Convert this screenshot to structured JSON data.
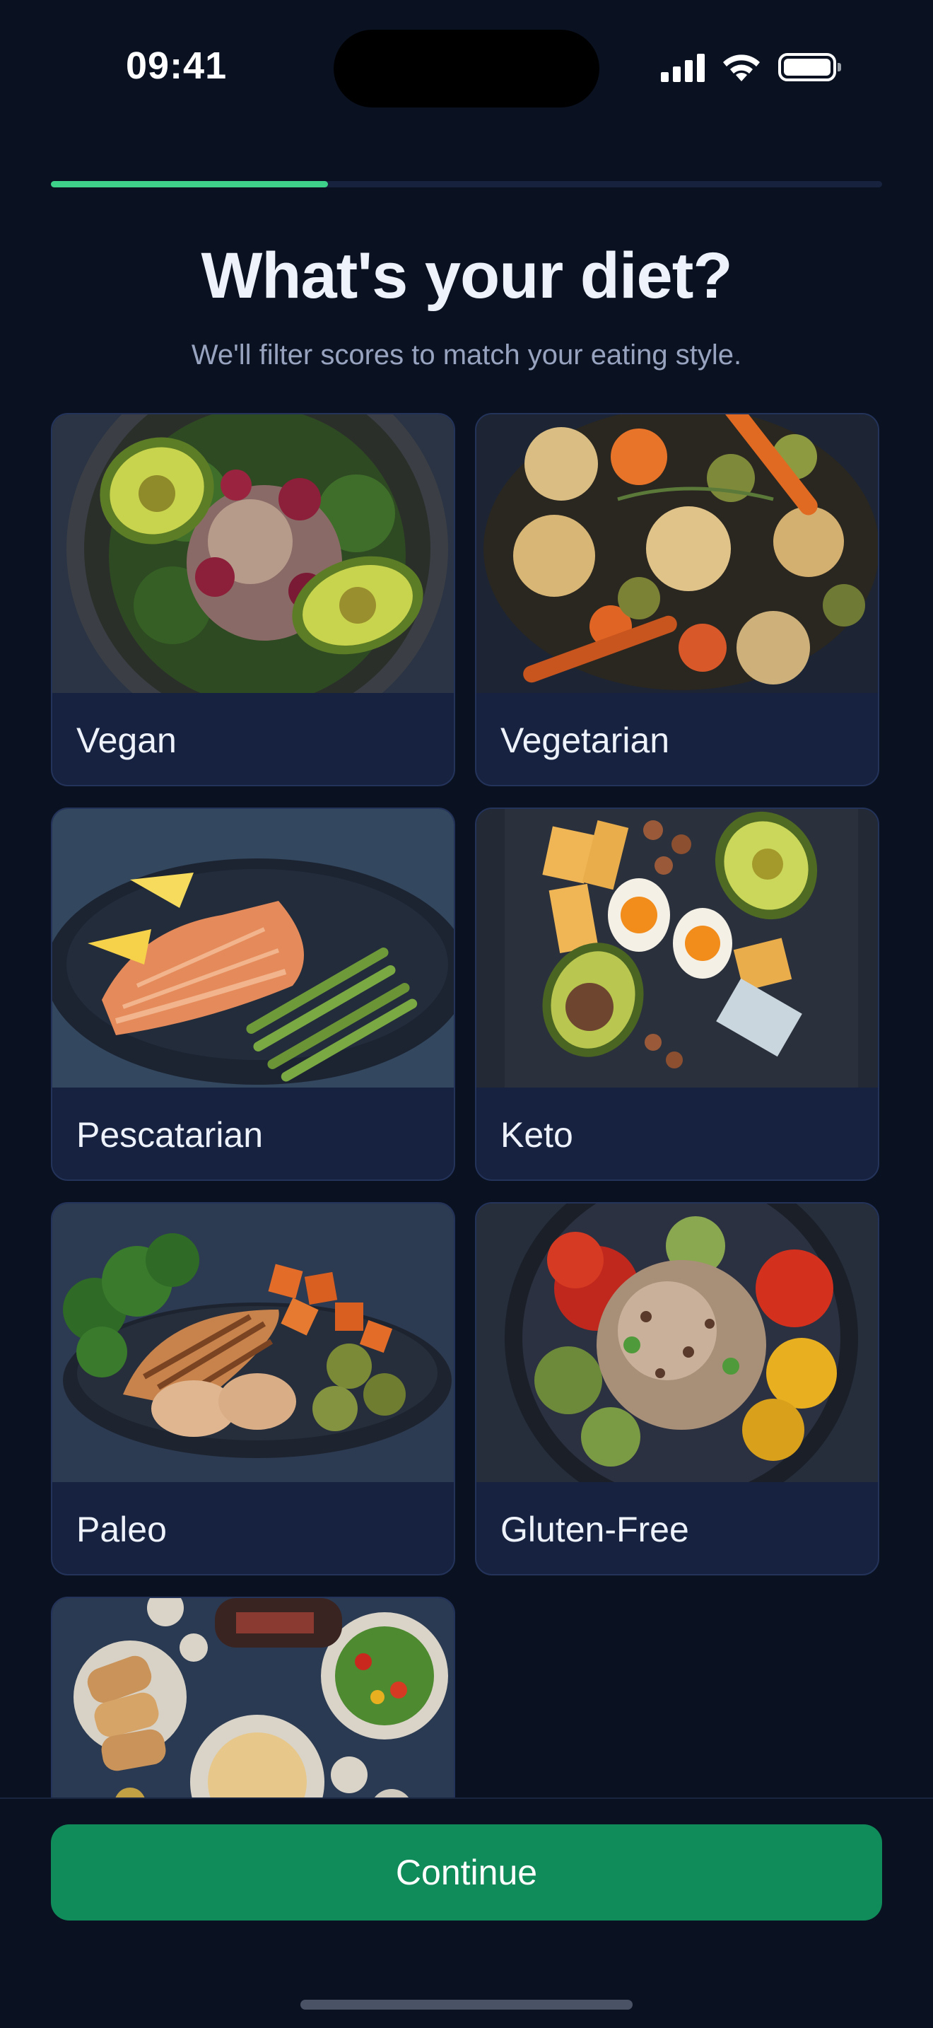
{
  "status_bar": {
    "time": "09:41",
    "icons": [
      "cellular-signal-icon",
      "wifi-icon",
      "battery-icon"
    ]
  },
  "progress": {
    "fraction": 0.333,
    "color": "#3ed18a"
  },
  "header": {
    "title": "What's your diet?",
    "subtitle": "We'll filter scores to match your eating style."
  },
  "diets": [
    {
      "label": "Vegan"
    },
    {
      "label": "Vegetarian"
    },
    {
      "label": "Pescatarian"
    },
    {
      "label": "Keto"
    },
    {
      "label": "Paleo"
    },
    {
      "label": "Gluten-Free"
    },
    {
      "label": ""
    }
  ],
  "footer": {
    "continue_label": "Continue",
    "button_color": "#108c5a"
  },
  "colors": {
    "background": "#0a1222",
    "card": "#16223f",
    "accent": "#3ed18a"
  }
}
